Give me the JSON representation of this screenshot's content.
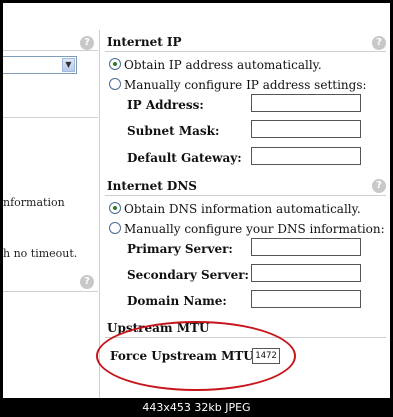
{
  "left": {
    "info_text": "nformation",
    "timeout_text": "h no timeout."
  },
  "internet_ip": {
    "title": "Internet IP",
    "option_auto": "Obtain IP address automatically.",
    "option_manual": "Manually configure IP address settings:",
    "selected": "auto",
    "fields": [
      {
        "label": "IP Address:",
        "value": ""
      },
      {
        "label": "Subnet Mask:",
        "value": ""
      },
      {
        "label": "Default Gateway:",
        "value": ""
      }
    ]
  },
  "internet_dns": {
    "title": "Internet DNS",
    "option_auto": "Obtain DNS information automatically.",
    "option_manual": "Manually configure your DNS information:",
    "selected": "auto",
    "fields": [
      {
        "label": "Primary Server:",
        "value": ""
      },
      {
        "label": "Secondary Server:",
        "value": ""
      },
      {
        "label": "Domain Name:",
        "value": ""
      }
    ]
  },
  "upstream_mtu": {
    "title": "Upstream MTU",
    "force_label": "Force Upstream MTU:",
    "value": "1472"
  },
  "help_icon_glyph": "?",
  "dropdown_arrow": "▼",
  "caption": "443x453 32kb JPEG",
  "colors": {
    "highlight_oval": "#c8151b",
    "help_icon": "#c8c8c8"
  }
}
